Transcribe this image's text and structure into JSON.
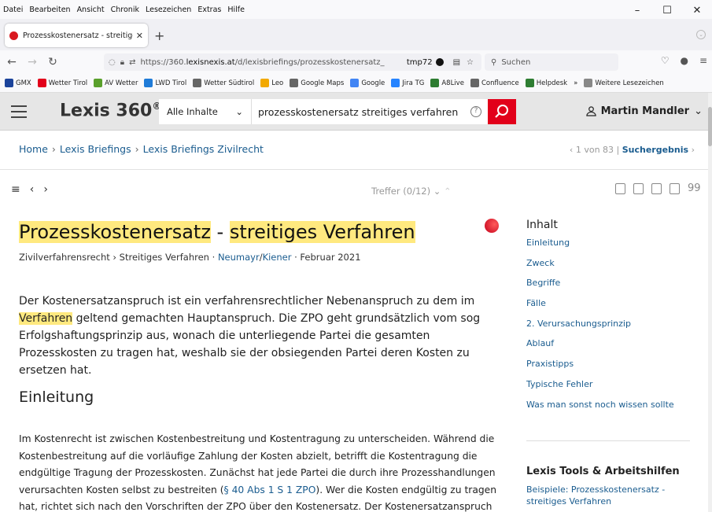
{
  "browser": {
    "menu": [
      "Datei",
      "Bearbeiten",
      "Ansicht",
      "Chronik",
      "Lesezeichen",
      "Extras",
      "Hilfe"
    ],
    "window_controls": [
      "–",
      "☐",
      "✕"
    ],
    "tab_title": "Prozesskostenersatz - streitiges",
    "tab_close": "✕",
    "new_tab": "+",
    "url_prefix": "https://360.",
    "url_domain": "lexisnexis.at",
    "url_path": "/d/lexisbriefings/prozesskostenersatz_",
    "url_tmp": "tmp72",
    "search_placeholder": "Suchen",
    "bookmarks": [
      {
        "label": "GMX",
        "color": "#1c449b"
      },
      {
        "label": "Wetter Tirol",
        "color": "#e2001a"
      },
      {
        "label": "AV Wetter",
        "color": "#5aa02c"
      },
      {
        "label": "LWD Tirol",
        "color": "#1f7bd8"
      },
      {
        "label": "Wetter Südtirol",
        "color": "#666666"
      },
      {
        "label": "Leo",
        "color": "#f2a900"
      },
      {
        "label": "Google Maps",
        "color": "#666666"
      },
      {
        "label": "Google",
        "color": "#4285f4"
      },
      {
        "label": "Jira TG",
        "color": "#2684ff"
      },
      {
        "label": "A8Live",
        "color": "#2e7d32"
      },
      {
        "label": "Confluence",
        "color": "#666666"
      },
      {
        "label": "Helpdesk",
        "color": "#2e7d32"
      },
      {
        "label": "Weitere Lesezeichen",
        "color": "#888888"
      }
    ],
    "bookmarks_more": "»"
  },
  "lexis": {
    "logo": "Lexis 360",
    "logo_mark": "®",
    "scope": "Alle Inhalte",
    "query": "prozesskostenersatz streitiges verfahren",
    "help": "?",
    "user": "Martin Mandler"
  },
  "breadcrumb": {
    "items": [
      "Home",
      "Lexis Briefings",
      "Lexis Briefings Zivilrecht"
    ],
    "pager_text": "1 von 83 |",
    "pager_link": "Suchergebnis"
  },
  "toolbar": {
    "treffer": "Treffer (0/12)"
  },
  "article": {
    "title_a": "Prozesskostenersatz",
    "title_sep": " - ",
    "title_b": "streitiges Verfahren",
    "meta_path": "Zivilverfahrensrecht › Streitiges Verfahren ·",
    "meta_author1": "Neumayr",
    "meta_slash": "/",
    "meta_author2": "Kiener",
    "meta_date": "· Februar 2021",
    "lead_1": "Der Kostenersatzanspruch ist ein verfahrensrechtlicher Nebenanspruch zu dem im",
    "lead_hl": "Verfahren",
    "lead_2": " geltend gemachten Hauptanspruch. Die ZPO geht grundsätzlich vom sog Erfolgshaftungsprinzip aus, wonach die unterliegende Partei die gesamten Prozesskosten zu tragen hat, weshalb sie der obsiegenden Partei deren Kosten zu ersetzen hat.",
    "h2": "Einleitung",
    "body_1": "Im Kostenrecht ist zwischen Kostenbestreitung und Kostentragung zu unterscheiden. Während die Kostenbestreitung auf die vorläufige Zahlung der Kosten abzielt, betrifft die Kostentragung die endgültige Tragung der Prozesskosten. Zunächst hat jede Partei die durch ihre Prozesshandlungen verursachten Kosten selbst zu bestreiten (",
    "body_link": "§ 40 Abs 1 S 1 ZPO",
    "body_2": "). Wer die Kosten endgültig zu tragen hat, richtet sich nach den Vorschriften der ZPO über den Kostenersatz. Der Kostenersatzanspruch einer"
  },
  "toc": {
    "heading": "Inhalt",
    "items": [
      "Einleitung",
      "Zweck",
      "Begriffe",
      "Fälle",
      "2. Verursachungsprinzip",
      "Ablauf",
      "Praxistipps",
      "Typische Fehler",
      "Was man sonst noch wissen sollte"
    ]
  },
  "tools": {
    "heading": "Lexis Tools & Arbeitshilfen",
    "item": "Beispiele: Prozesskostenersatz - streitiges Verfahren"
  },
  "colors": {
    "accent_red": "#e2001a",
    "link_blue": "#1a5c8f",
    "highlight": "#ffe97f"
  }
}
